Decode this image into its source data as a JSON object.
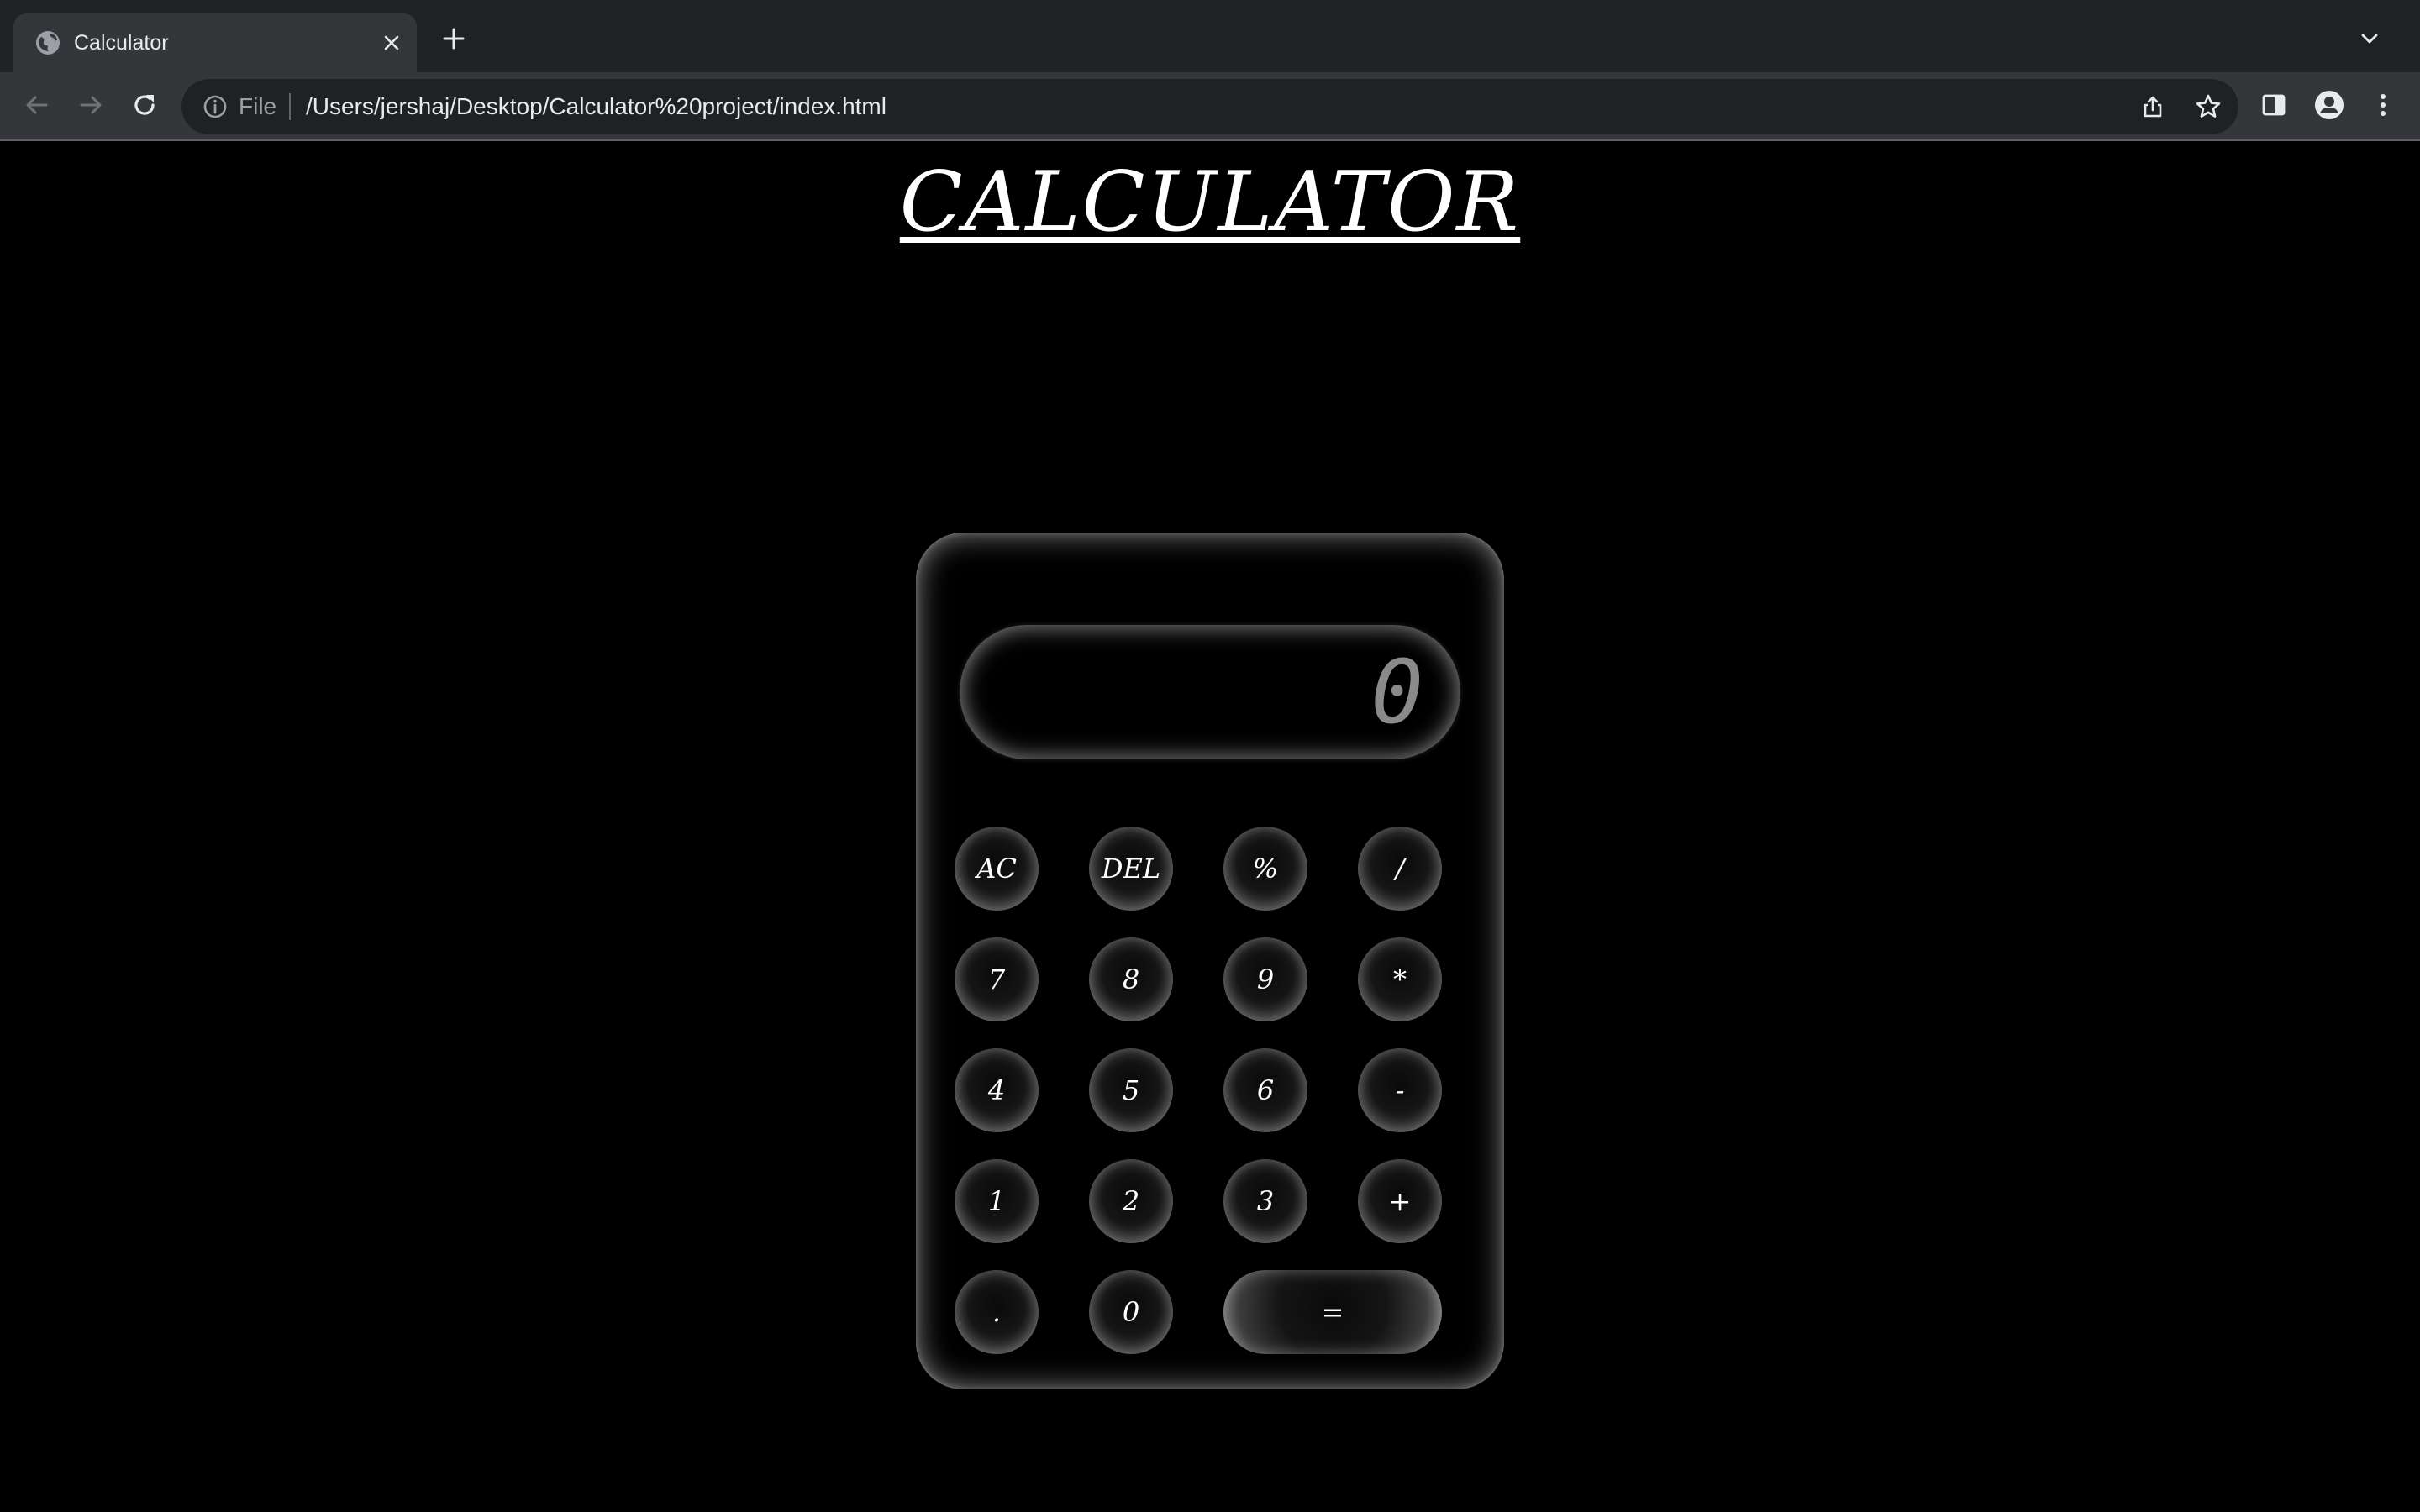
{
  "browser": {
    "tab": {
      "title": "Calculator"
    },
    "omnibox": {
      "scheme_label": "File",
      "url": "/Users/jershaj/Desktop/Calculator%20project/index.html"
    },
    "icons": {
      "favicon": "globe-icon",
      "close": "close-icon",
      "new_tab": "plus-icon",
      "tab_search": "chevron-down-icon",
      "back": "arrow-left-icon",
      "forward": "arrow-right-icon",
      "reload": "reload-icon",
      "info": "info-icon",
      "share": "share-icon",
      "bookmark": "star-icon",
      "side_panel": "side-panel-icon",
      "profile": "profile-icon",
      "menu": "kebab-menu-icon"
    }
  },
  "page": {
    "title": "CALCULATOR",
    "calculator": {
      "display_value": "0",
      "keys": [
        {
          "label": "AC",
          "name": "key-ac"
        },
        {
          "label": "DEL",
          "name": "key-del"
        },
        {
          "label": "%",
          "name": "key-percent"
        },
        {
          "label": "/",
          "name": "key-divide"
        },
        {
          "label": "7",
          "name": "key-7"
        },
        {
          "label": "8",
          "name": "key-8"
        },
        {
          "label": "9",
          "name": "key-9"
        },
        {
          "label": "*",
          "name": "key-multiply"
        },
        {
          "label": "4",
          "name": "key-4"
        },
        {
          "label": "5",
          "name": "key-5"
        },
        {
          "label": "6",
          "name": "key-6"
        },
        {
          "label": "-",
          "name": "key-subtract"
        },
        {
          "label": "1",
          "name": "key-1"
        },
        {
          "label": "2",
          "name": "key-2"
        },
        {
          "label": "3",
          "name": "key-3"
        },
        {
          "label": "+",
          "name": "key-add"
        },
        {
          "label": ".",
          "name": "key-decimal"
        },
        {
          "label": "0",
          "name": "key-0"
        },
        {
          "label": "=",
          "name": "key-equals"
        }
      ]
    }
  },
  "colors": {
    "page_background": "#000000",
    "chrome_tabstrip": "#202124",
    "chrome_toolbar": "#35363a",
    "text_primary": "#ffffff",
    "display_text": "#8a8a8a"
  }
}
